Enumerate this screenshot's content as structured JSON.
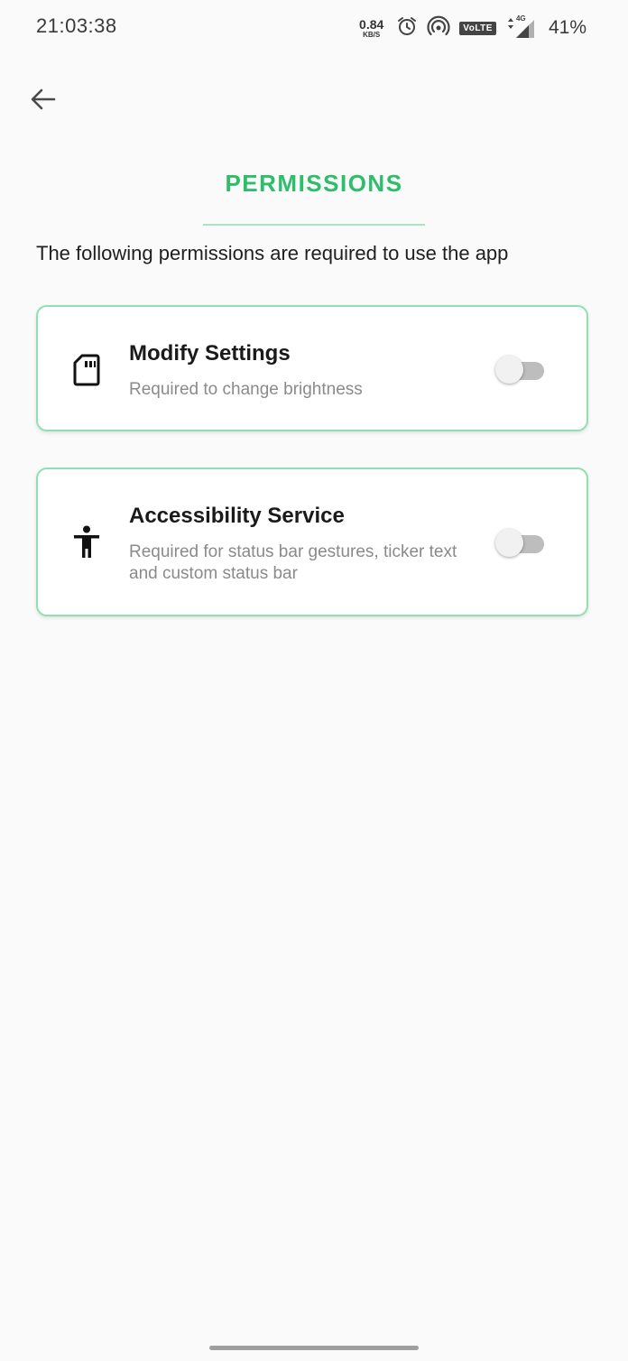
{
  "status_bar": {
    "time": "21:03:38",
    "net_speed_value": "0.84",
    "net_speed_unit": "KB/S",
    "volte_label": "VoLTE",
    "network_type": "4G",
    "battery": "41%",
    "icons": [
      "alarm-icon",
      "hotspot-icon",
      "volte-icon",
      "signal-icon"
    ]
  },
  "header": {
    "back_icon": "arrow-left-icon",
    "title": "PERMISSIONS"
  },
  "intro": "The following permissions are required to use the app",
  "permissions": [
    {
      "icon": "sd-card-icon",
      "title": "Modify Settings",
      "description": "Required to change brightness",
      "enabled": false
    },
    {
      "icon": "accessibility-icon",
      "title": "Accessibility Service",
      "description": "Required for status bar gestures, ticker text and custom status bar",
      "enabled": false
    }
  ],
  "colors": {
    "accent": "#2ebd6b",
    "card_border": "#8fe0b0",
    "background": "#fafafa"
  }
}
